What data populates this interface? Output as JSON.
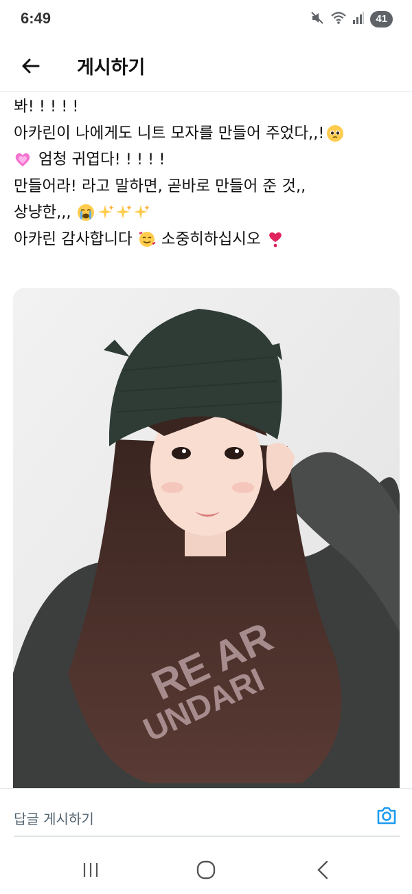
{
  "status_bar": {
    "time": "6:49",
    "battery": "41",
    "icons": [
      "mute-icon",
      "wifi-icon",
      "signal-icon",
      "battery-icon"
    ]
  },
  "header": {
    "title": "게시하기",
    "back_icon": "arrow-left-icon"
  },
  "post": {
    "lines": [
      {
        "text": "봐! ! ! ! !"
      },
      {
        "text": "아카린이 나에게도 니트 모자를 만들어 주었다,,!",
        "emoji_after": "pleading-face"
      },
      {
        "emoji_before": "pink-heart",
        "text": "엄청 귀엽다! ! ! ! !"
      },
      {
        "text": "만들어라! 라고 말하면, 곧바로 만들어 준 것,,"
      },
      {
        "text": "상냥한,,,",
        "emoji_after": "crying-face sparkles sparkles sparkles"
      },
      {
        "text": "아카린 감사합니다",
        "emoji_mid": "smiling-face-with-hearts",
        "text2": "소중히하십시오",
        "emoji_after": "heart-exclamation"
      }
    ],
    "image": "photo-woman-knit-cat-ear-hat"
  },
  "reply": {
    "placeholder": "답글 게시하기",
    "camera_icon": "camera-icon"
  },
  "nav": {
    "icons": [
      "recent-apps-icon",
      "home-icon",
      "back-icon"
    ]
  },
  "colors": {
    "accent": "#1d9bf0",
    "text": "#0f1419",
    "secondary": "#536471"
  }
}
